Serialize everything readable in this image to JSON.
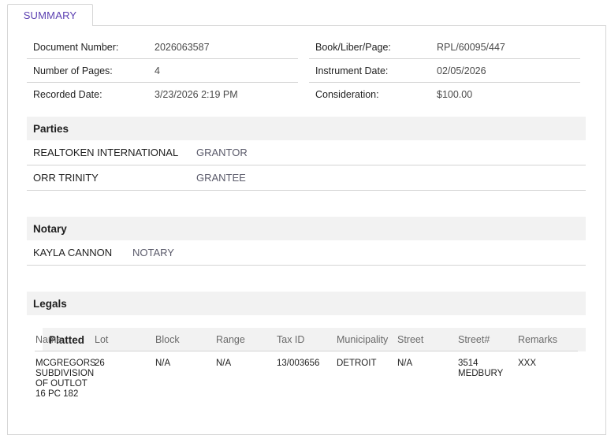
{
  "tab": {
    "label": "SUMMARY"
  },
  "document": {
    "left": [
      {
        "label": "Document Number:",
        "value": "2026063587"
      },
      {
        "label": "Number of Pages:",
        "value": "4"
      },
      {
        "label": "Recorded Date:",
        "value": "3/23/2026 2:19 PM"
      }
    ],
    "right": [
      {
        "label": "Book/Liber/Page:",
        "value": "RPL/60095/447"
      },
      {
        "label": "Instrument Date:",
        "value": "02/05/2026"
      },
      {
        "label": "Consideration:",
        "value": "$100.00"
      }
    ]
  },
  "parties": {
    "title": "Parties",
    "rows": [
      {
        "name": "REALTOKEN INTERNATIONAL",
        "role": "GRANTOR"
      },
      {
        "name": "ORR TRINITY",
        "role": "GRANTEE"
      }
    ]
  },
  "notary": {
    "title": "Notary",
    "rows": [
      {
        "name": "KAYLA CANNON",
        "role": "NOTARY"
      }
    ]
  },
  "legals": {
    "title": "Legals",
    "platted": {
      "title": "Platted",
      "columns": [
        "Name",
        "Lot",
        "Block",
        "Range",
        "Tax ID",
        "Municipality",
        "Street",
        "Street#",
        "Remarks"
      ],
      "rows": [
        {
          "name": "MCGREGORS SUBDIVISION OF OUTLOT 16 PC 182",
          "lot": "26",
          "block": "N/A",
          "range": "N/A",
          "tax_id": "13/003656",
          "municipality": "DETROIT",
          "street": "N/A",
          "street_no": "3514 MEDBURY",
          "remarks": "XXX"
        }
      ]
    }
  }
}
